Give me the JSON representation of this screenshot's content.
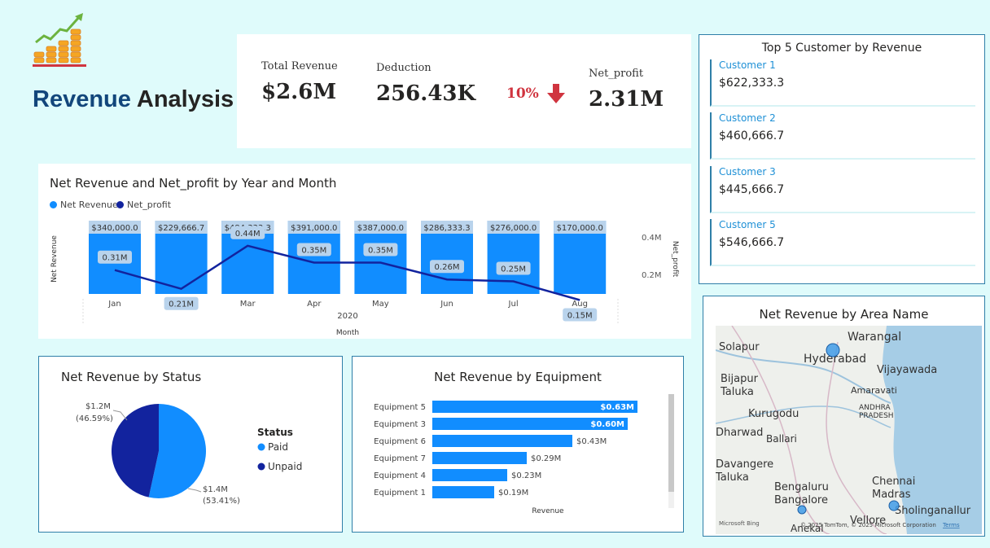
{
  "header": {
    "title_word1": "Revenue",
    "title_word2": "Analysis"
  },
  "kpis": {
    "total_revenue_label": "Total Revenue",
    "total_revenue_value": "$2.6M",
    "deduction_label": "Deduction",
    "deduction_value": "256.43K",
    "deduction_pct": "10%",
    "net_profit_label": "Net_profit",
    "net_profit_value": "2.31M",
    "trend_icon": "arrow-down-icon",
    "trend_color": "#d0343f"
  },
  "top_customers": {
    "title": "Top 5 Customer by Revenue",
    "items": [
      {
        "name": "Customer 1",
        "value": "$622,333.3"
      },
      {
        "name": "Customer 2",
        "value": "$460,666.7"
      },
      {
        "name": "Customer 3",
        "value": "$445,666.7"
      },
      {
        "name": "Customer 5",
        "value": "$546,666.7"
      }
    ]
  },
  "map": {
    "title": "Net Revenue by Area Name",
    "places": [
      "Warangal",
      "Solapur",
      "Hyderabad",
      "Vijayawada",
      "Bijapur Taluka",
      "Amaravati",
      "ANDHRA PRADESH",
      "Kurugodu",
      "Dharwad",
      "Ballari",
      "Davangere Taluka",
      "Bengaluru Bangalore",
      "Chennai Madras",
      "Sholinganallur",
      "Vellore",
      "Anekal"
    ],
    "attribution": "© 2025 TomTom, © 2025 Microsoft Corporation",
    "terms": "Terms",
    "bing": "Microsoft Bing"
  },
  "colors": {
    "accent": "#118dff",
    "dark_series": "#12239e",
    "background": "#dffbfb",
    "border": "#2f7fa8"
  },
  "chart_data": [
    {
      "type": "bar",
      "title": "Net Revenue and Net_profit by Year and Month",
      "categories": [
        "Jan",
        "Feb",
        "Mar",
        "Apr",
        "May",
        "Jun",
        "Jul",
        "Aug"
      ],
      "year_label": "2020",
      "xlabel": "Month",
      "ylabel": "Net Revenue",
      "y2label": "Net_profit",
      "y2_ticks": [
        "0.4M",
        "0.2M"
      ],
      "series": [
        {
          "name": "Net Revenue",
          "type": "bar",
          "values": [
            340000,
            229666.7,
            484333.3,
            391000,
            387000,
            286333.3,
            276000,
            170000
          ],
          "labels": [
            "$340,000.0",
            "$229,666.7",
            "$484,333.3",
            "$391,000.0",
            "$387,000.0",
            "$286,333.3",
            "$276,000.0",
            "$170,000.0"
          ],
          "color": "#118dff"
        },
        {
          "name": "Net_profit",
          "type": "line",
          "values": [
            0.31,
            0.21,
            0.44,
            0.35,
            0.35,
            0.26,
            0.25,
            0.15
          ],
          "labels": [
            "0.31M",
            "0.21M",
            "0.44M",
            "0.35M",
            "0.35M",
            "0.26M",
            "0.25M",
            "0.15M"
          ],
          "color": "#12239e"
        }
      ],
      "legend": "top-left"
    },
    {
      "type": "pie",
      "title": "Net Revenue by Status",
      "legend_title": "Status",
      "slices": [
        {
          "name": "Paid",
          "value": 1.4,
          "percent": 53.41,
          "label": "$1.4M",
          "pct_label": "(53.41%)",
          "color": "#118dff"
        },
        {
          "name": "Unpaid",
          "value": 1.2,
          "percent": 46.59,
          "label": "$1.2M",
          "pct_label": "(46.59%)",
          "color": "#12239e"
        }
      ],
      "legend": "right"
    },
    {
      "type": "bar",
      "orientation": "horizontal",
      "title": "Net Revenue by Equipment",
      "categories": [
        "Equipment 5",
        "Equipment 3",
        "Equipment 6",
        "Equipment 7",
        "Equipment 4",
        "Equipment 1"
      ],
      "values": [
        0.63,
        0.6,
        0.43,
        0.29,
        0.23,
        0.19
      ],
      "labels": [
        "$0.63M",
        "$0.60M",
        "$0.43M",
        "$0.29M",
        "$0.23M",
        "$0.19M"
      ],
      "xlabel": "Revenue",
      "color": "#118dff"
    }
  ]
}
